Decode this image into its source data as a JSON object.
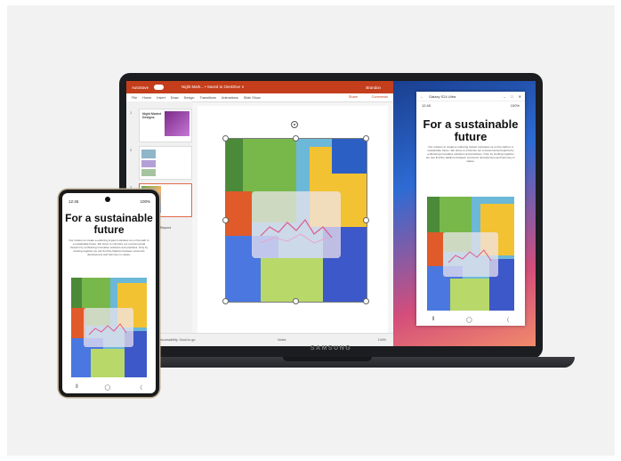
{
  "ppt": {
    "autosave_label": "AutoSave",
    "file_title": "Night Mark... • Saved to OneDrive ∨",
    "user": "Brandon",
    "menu": [
      "File",
      "Home",
      "Insert",
      "Draw",
      "Design",
      "Transitions",
      "Animations",
      "Slide Show"
    ],
    "share": "Share",
    "comments": "Comments",
    "thumbnails": [
      {
        "num": "1",
        "title": "Night Market Designs"
      },
      {
        "num": "2",
        "title": ""
      },
      {
        "num": "3",
        "title": ""
      }
    ],
    "thumb4_caption": "Journey and Beyond",
    "status_left": "Accessibility: Good to go",
    "status_notes": "Notes",
    "status_zoom": "104%"
  },
  "mirror": {
    "device_name": "Galaxy S24 Ultra",
    "time": "12:45",
    "battery": "100%",
    "headline": "For a sustainable future",
    "body": "Our mission to create a enduring impact motivates us on the path to a sustainable future. We strive to minimize our environmental footprint by embracing innovative solutions and practices. Only by working together we can find the balance between economic development and harmony in nature.",
    "nav": [
      "⦀",
      "◯",
      "〈"
    ]
  },
  "phone": {
    "time": "12:45",
    "battery": "100%",
    "headline": "For a sustainable future",
    "body": "Our mission to create a enduring impact motivates us on the path to a sustainable future. We strive to minimize our environmental footprint by embracing innovative solutions and practices. Only by working together we can find the balance between economic development and harmony in nature.",
    "nav": [
      "⦀",
      "◯",
      "〈"
    ]
  },
  "brand": "SAMSUNG",
  "colors": {
    "ppt_accent": "#c43e1c"
  }
}
